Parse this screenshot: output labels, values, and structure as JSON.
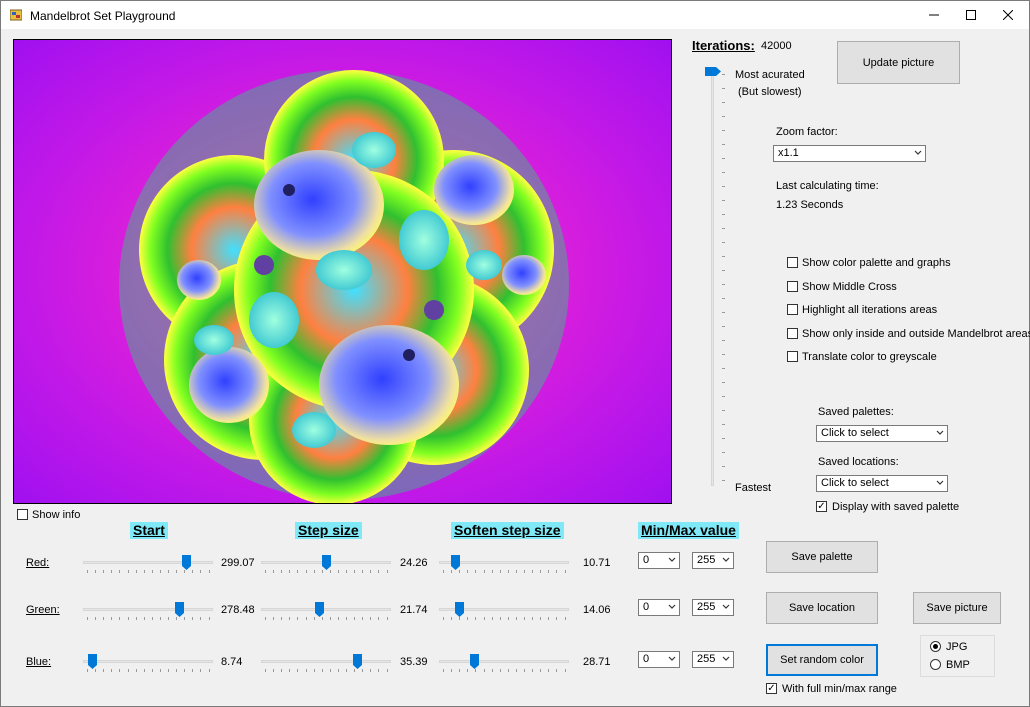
{
  "window": {
    "title": "Mandelbrot Set Playground"
  },
  "iterations": {
    "label": "Iterations:",
    "value": "42000",
    "top_label": "Most acurated",
    "top_sublabel": "(But slowest)",
    "bottom_label": "Fastest"
  },
  "buttons": {
    "update": "Update picture",
    "save_palette": "Save  palette",
    "save_location": "Save location",
    "save_picture": "Save picture",
    "random_color": "Set random color"
  },
  "zoom": {
    "label": "Zoom factor:",
    "value": "x1.1"
  },
  "timing": {
    "label": "Last calculating time:",
    "value": "1.23 Seconds"
  },
  "options": [
    {
      "label": "Show color palette and graphs",
      "checked": false
    },
    {
      "label": "Show Middle Cross",
      "checked": false
    },
    {
      "label": "Highlight all iterations areas",
      "checked": false
    },
    {
      "label": "Show only inside and outside Mandelbrot areas",
      "checked": false
    },
    {
      "label": "Translate color to greyscale",
      "checked": false
    }
  ],
  "saved_palettes": {
    "label": "Saved palettes:",
    "value": "Click to select"
  },
  "saved_locations": {
    "label": "Saved locations:",
    "value": "Click to select"
  },
  "display_with_saved_palette": {
    "label": "Display with saved palette",
    "checked": true
  },
  "show_info": {
    "label": "Show info",
    "checked": false
  },
  "headers": {
    "start": "Start",
    "step": "Step size",
    "soften": "Soften step size",
    "minmax": "Min/Max value"
  },
  "channels": [
    {
      "name": "Red:",
      "start": "299.07",
      "start_frac": 0.82,
      "step": "24.26",
      "step_frac": 0.5,
      "soften": "10.71",
      "soften_frac": 0.1,
      "min": "0",
      "max": "255"
    },
    {
      "name": "Green:",
      "start": "278.48",
      "start_frac": 0.76,
      "step": "21.74",
      "step_frac": 0.45,
      "soften": "14.06",
      "soften_frac": 0.13,
      "min": "0",
      "max": "255"
    },
    {
      "name": "Blue:",
      "start": "8.74",
      "start_frac": 0.04,
      "step": "35.39",
      "step_frac": 0.76,
      "soften": "28.71",
      "soften_frac": 0.26,
      "min": "0",
      "max": "255"
    }
  ],
  "full_minmax": {
    "label": "With full min/max range",
    "checked": true
  },
  "format": {
    "options": [
      "JPG",
      "BMP"
    ],
    "selected": "JPG"
  },
  "colors": {
    "accent": "#0078d7",
    "header_bg": "#7fe9f7"
  }
}
